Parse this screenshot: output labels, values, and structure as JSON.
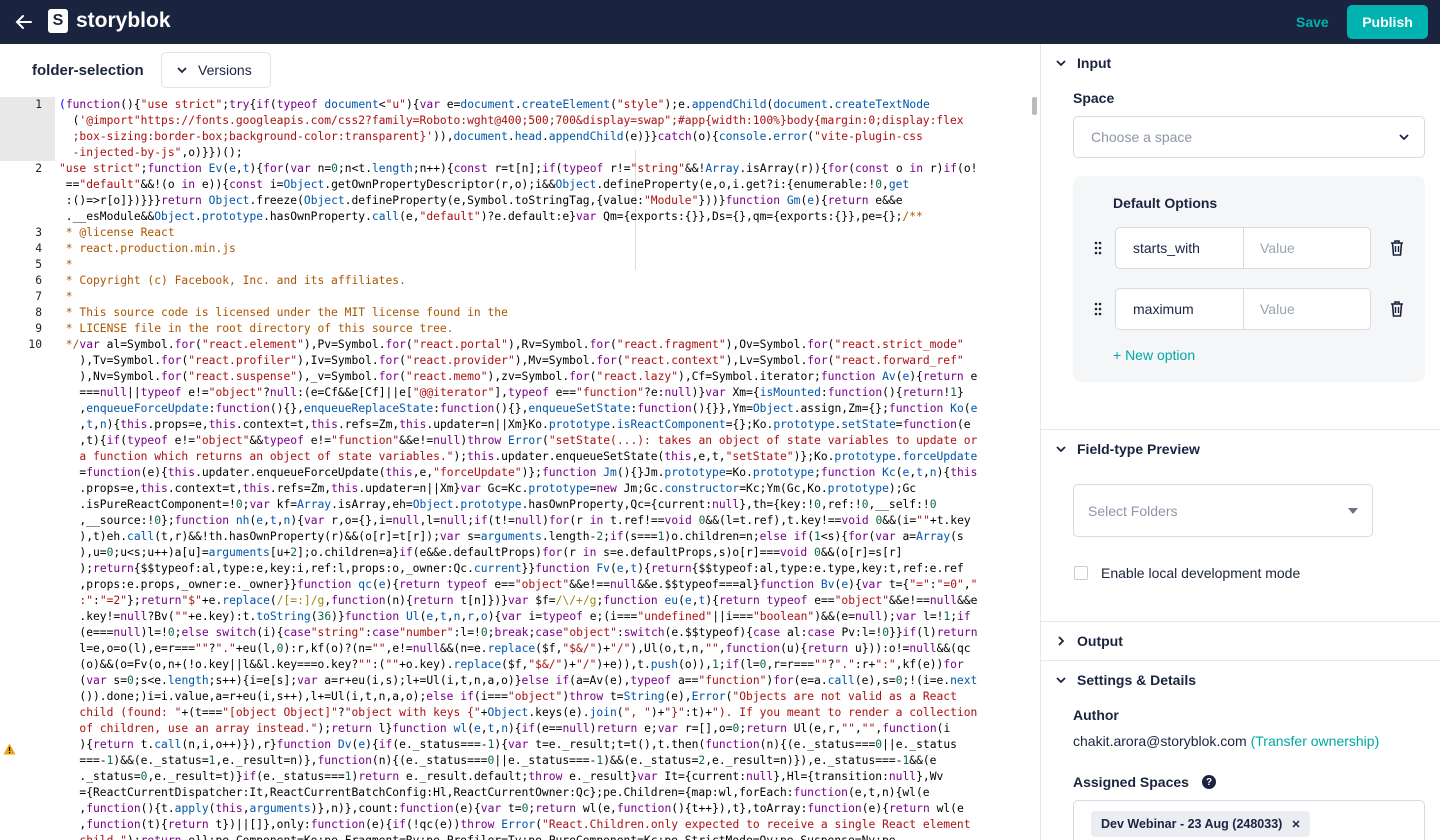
{
  "topbar": {
    "logo_text": "storyblok",
    "save_label": "Save",
    "publish_label": "Publish",
    "accent": "#00b3b0",
    "bg": "#1b243f"
  },
  "component": {
    "title": "folder-selection",
    "versions_label": "Versions"
  },
  "editor": {
    "line_numbers": [
      "1",
      "2",
      "3",
      "4",
      "5",
      "6",
      "7",
      "8",
      "9",
      "10"
    ]
  },
  "panel": {
    "input": {
      "title": "Input",
      "space_label": "Space",
      "space_placeholder": "Choose a space",
      "default_options_label": "Default Options",
      "options": [
        {
          "key": "starts_with",
          "value_placeholder": "Value"
        },
        {
          "key": "maximum",
          "value_placeholder": "Value"
        }
      ],
      "new_option_label": "+ New option"
    },
    "preview": {
      "title": "Field-type Preview",
      "select_placeholder": "Select Folders",
      "local_dev_label": "Enable local development mode"
    },
    "output": {
      "title": "Output"
    },
    "settings": {
      "title": "Settings & Details",
      "author_label": "Author",
      "author_email": "chakit.arora@storyblok.com",
      "transfer_label": "(Transfer ownership)",
      "assigned_spaces_label": "Assigned Spaces",
      "spaces": [
        "Dev Webinar - 23 Aug (248033)"
      ]
    }
  }
}
